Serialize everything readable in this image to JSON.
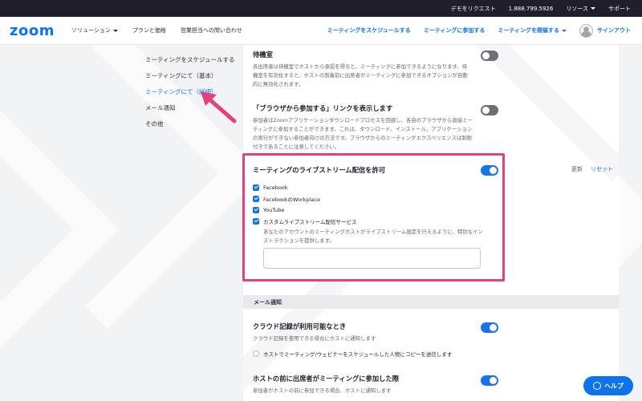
{
  "topbar": {
    "demo": "デモをリクエスト",
    "phone": "1.888.799.5926",
    "resources": "リソース",
    "support": "サポート"
  },
  "navbar": {
    "logo": "zoom",
    "solutions": "ソリューション",
    "plans": "プランと価格",
    "contact_sales": "営業担当への問い合わせ",
    "schedule": "ミーティングをスケジュールする",
    "join": "ミーティングに参加する",
    "host": "ミーティングを開催する",
    "signout": "サインアウト"
  },
  "leftmenu": {
    "items": [
      "ミーティングをスケジュールする",
      "ミーティングにて（基本）",
      "ミーティングにて（詳細）",
      "メール通知",
      "その他"
    ],
    "active_index": 2
  },
  "settings": {
    "waiting_room": {
      "title": "待機室",
      "desc": "各出席者は待機室でホストから承認を得ると、ミーティングに参加できるようになります。待機室を有効化すると、ホストの到着前に出席者がミーティングに参加できるオプションが自動的に無効化されます。",
      "enabled": false
    },
    "browser_join": {
      "title": "「ブラウザから参加する」リンクを表示します",
      "desc": "参加者はZoomアプリケーションダウンロードプロセスを回避し、各自のブラウザから直接ミーティングに参加することができます。これは、ダウンロード、インストール、アプリケーションの実行ができない参加者向けの方法です。ブラウザからのミーティングエクスペリエンスは制限付きであることに注意してください。",
      "enabled": false
    },
    "livestream": {
      "title": "ミーティングのライブストリーム配信を許可",
      "enabled": true,
      "options": [
        "Facebook",
        "FacebookのWorkplace",
        "YouTube",
        "カスタムライブストリーム配信サービス"
      ],
      "custom_desc": "あなたのアカウントのミーティングホストがライブストリーム設定を行えるように、特別なインストラクションを提供します。",
      "textarea_value": ""
    },
    "side_actions": {
      "update": "更新",
      "reset": "リセット"
    },
    "email_section": "メール通知",
    "cloud_recording": {
      "title": "クラウド記録が利用可能なとき",
      "desc": "クラウド記録を使用できる場合にホストに通知します",
      "enabled": true,
      "copy_option": "ホストでミーティング/ウェビナーをスケジュールした人物にコピーを送信します"
    },
    "attendee_before_host": {
      "title": "ホストの前に出席者がミーティングに参加した際",
      "desc": "参加者がホストの前に参加できる場合、ホストに通知します",
      "enabled": true
    }
  },
  "help": "ヘルプ",
  "colors": {
    "brand": "#0e72ed",
    "highlight": "#e0427a",
    "toggle_on": "#1a73e8",
    "toggle_off": "#6e7079"
  }
}
